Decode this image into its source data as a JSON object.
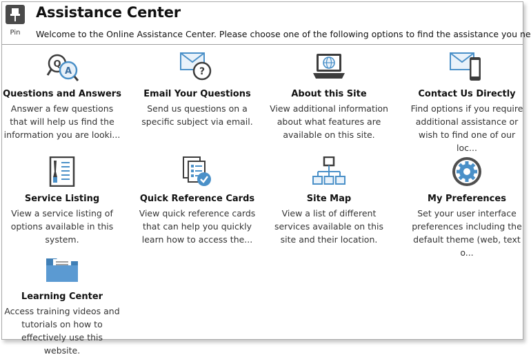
{
  "header": {
    "pin_label": "Pin",
    "title": "Assistance Center",
    "welcome": "Welcome to the Online Assistance Center. Please choose one of the following options to find the assistance you need."
  },
  "tiles": [
    {
      "title": "Questions and Answers",
      "desc": "Answer a few questions that will help us find the information you are looki...",
      "icon": "qa-icon"
    },
    {
      "title": "Email Your Questions",
      "desc": "Send us questions on a specific subject via email.",
      "icon": "email-question-icon"
    },
    {
      "title": "About this Site",
      "desc": "View additional information about what features are available on this site.",
      "icon": "laptop-globe-icon"
    },
    {
      "title": "Contact Us Directly",
      "desc": "Find options if you require additional assistance or wish to find one of our loc...",
      "icon": "email-phone-icon"
    },
    {
      "title": "Service Listing",
      "desc": "View a service listing of options available in this system.",
      "icon": "service-listing-icon"
    },
    {
      "title": "Quick Reference Cards",
      "desc": "View quick reference cards that can help you quickly learn how to access the...",
      "icon": "reference-cards-icon"
    },
    {
      "title": "Site Map",
      "desc": "View a list of different services available on this site and their location.",
      "icon": "sitemap-icon"
    },
    {
      "title": "My Preferences",
      "desc": "Set your user interface preferences including the default theme (web, text o...",
      "icon": "gear-icon"
    },
    {
      "title": "Learning Center",
      "desc": "Access training videos and tutorials on how to effectively use this website.",
      "icon": "folder-icon"
    }
  ],
  "colors": {
    "icon_blue": "#4a90c8",
    "icon_dark": "#3c3c3c",
    "border": "#a9a9a9"
  }
}
